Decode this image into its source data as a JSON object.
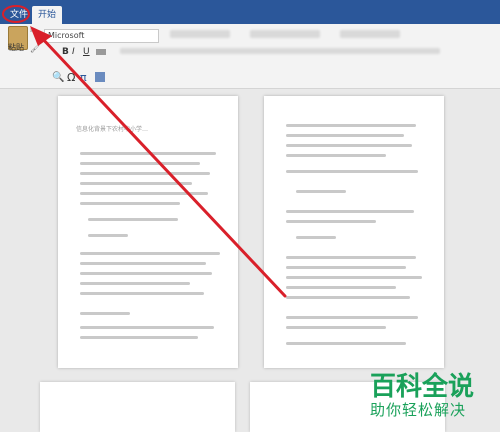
{
  "tabs": {
    "file": "文件",
    "home": "开始"
  },
  "ribbon": {
    "paste_label": "粘贴",
    "font_name": "Microsoft",
    "bold": "B",
    "italic": "I",
    "underline": "U",
    "omega_symbol": "Ω",
    "pi_symbol": "π"
  },
  "document": {
    "title": "信息化背景下农村中小学…"
  },
  "watermark": {
    "title": "百科全说",
    "subtitle": "助你轻松解决"
  },
  "colors": {
    "titlebar": "#2b579a",
    "annotation": "#d9202a",
    "watermark": "#1aa15a"
  }
}
